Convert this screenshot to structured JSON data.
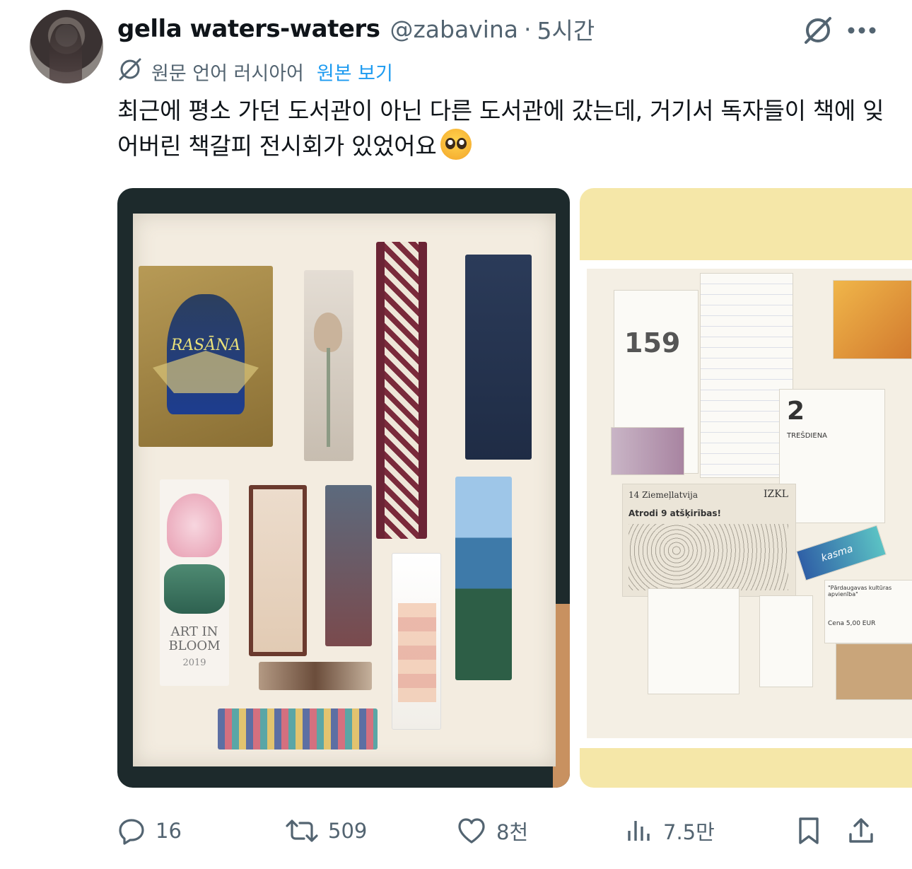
{
  "author": {
    "display_name": "gella waters-waters",
    "handle": "@zabavina",
    "separator": "·",
    "time": "5시간"
  },
  "translation": {
    "source_language": "원문 언어 러시아어",
    "show_original": "원본 보기"
  },
  "tweet": {
    "text": "최근에 평소 가던 도서관이 아닌 다른 도서관에 갔는데, 거기서 독자들이 책에 잊어버린 책갈피 전시회가 있었어요"
  },
  "photo_texts": {
    "photo1_bookmark_art": "ART IN BLOOM",
    "photo1_bookmark_year": "2019",
    "photo1_bookmark_rasa": "RASĀNA",
    "photo2_calendar_number": "159",
    "photo2_day": "2",
    "photo2_day_name": "TREŠDIENA",
    "photo2_newspaper": "Atrodi 9 atšķirības!",
    "photo2_newspaper_head": "14 Ziemeļlatvija",
    "photo2_izkl": "IZKL",
    "photo2_ticket": "\"Pārdaugavas kultūras apvienība\"",
    "photo2_price": "Cena 5,00 EUR",
    "photo2_candy": "kasma"
  },
  "actions": {
    "replies": "16",
    "reposts": "509",
    "likes": "8천",
    "views": "7.5만"
  },
  "icons": [
    "grok-icon",
    "more-icon",
    "translate-icon",
    "reply-icon",
    "repost-icon",
    "like-icon",
    "views-icon",
    "bookmark-icon",
    "share-icon"
  ],
  "colors": {
    "text": "#0f1419",
    "secondary": "#536471",
    "link": "#1d9bf0"
  }
}
